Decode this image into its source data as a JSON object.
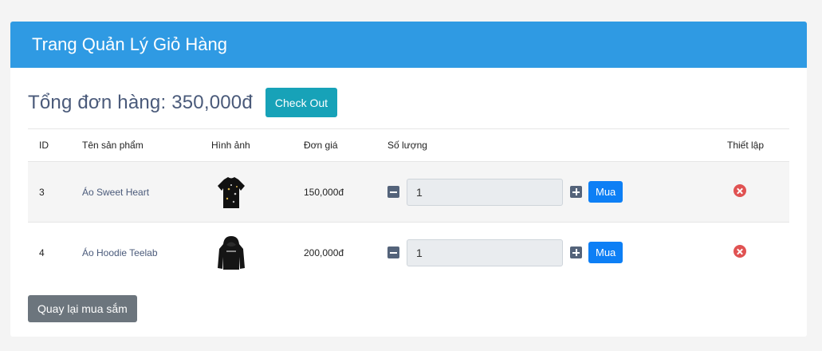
{
  "header": {
    "title": "Trang Quản Lý Giỏ Hàng"
  },
  "summary": {
    "total_label": "Tổng đơn hàng: 350,000đ",
    "checkout_label": "Check Out"
  },
  "table": {
    "columns": [
      "ID",
      "Tên sản phẩm",
      "Hình ảnh",
      "Đơn giá",
      "Số lượng",
      "Thiết lập"
    ],
    "rows": [
      {
        "id": "3",
        "name": "Áo Sweet Heart",
        "image": "black-shirt-thumbnail",
        "price": "150,000đ",
        "quantity": "1",
        "buy_label": "Mua"
      },
      {
        "id": "4",
        "name": "Áo Hoodie Teelab",
        "image": "black-hoodie-thumbnail",
        "price": "200,000đ",
        "quantity": "1",
        "buy_label": "Mua"
      }
    ]
  },
  "footer": {
    "back_label": "Quay lại mua sắm"
  },
  "colors": {
    "header_bg": "#2f9ae3",
    "checkout_bg": "#17a2b8",
    "buy_bg": "#0d7ff5",
    "back_bg": "#6c757d",
    "remove_icon": "#e05252"
  },
  "icons": {
    "decrease": "minus-square-icon",
    "increase": "plus-square-icon",
    "remove": "remove-circle-icon"
  }
}
